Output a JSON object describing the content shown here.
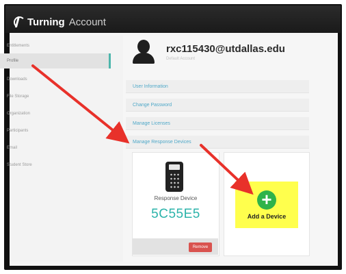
{
  "app": {
    "brand": "Turning",
    "product": "Account"
  },
  "sidebar": {
    "items": [
      {
        "label": "Entitlements"
      },
      {
        "label": "Profile",
        "active": true
      },
      {
        "label": "Downloads"
      },
      {
        "label": "File Storage"
      },
      {
        "label": "Organization"
      },
      {
        "label": "Participants"
      },
      {
        "label": "Email"
      },
      {
        "label": "Student Store"
      }
    ]
  },
  "profile": {
    "username": "rxc115430@utdallas.edu",
    "subtext": "Default Account"
  },
  "sections": [
    "User Information",
    "Change Password",
    "Manage Licenses",
    "Manage Response Devices"
  ],
  "device_card": {
    "label": "Response Device",
    "device_id": "5C55E5",
    "remove_label": "Remove"
  },
  "add_card": {
    "icon": "plus-icon",
    "label": "Add a Device",
    "highlight_color": "#ffff4d"
  },
  "colors": {
    "accent": "#4db6ac",
    "device_id": "#2bb3aa",
    "remove": "#d9534f",
    "add": "#2fb34a",
    "annotation_arrow": "#e8312a"
  }
}
